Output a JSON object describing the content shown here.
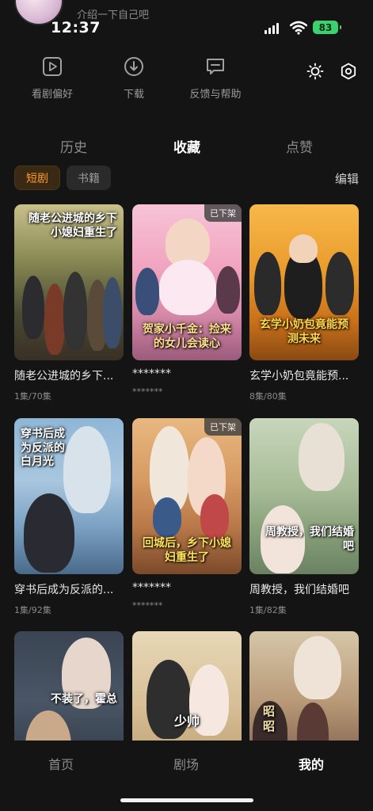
{
  "profile": {
    "intro": "介绍一下自己吧"
  },
  "status_bar": {
    "time": "12:37",
    "battery": "83"
  },
  "quick_actions": [
    {
      "label": "看剧偏好",
      "icon": "play-square-icon"
    },
    {
      "label": "下载",
      "icon": "download-icon"
    },
    {
      "label": "反馈与帮助",
      "icon": "feedback-icon"
    }
  ],
  "top_icons": [
    "brightness-icon",
    "settings-icon"
  ],
  "tabs": {
    "history": "历史",
    "favorites": "收藏",
    "likes": "点赞",
    "active": "收藏"
  },
  "filters": {
    "short_drama": "短剧",
    "books": "书籍",
    "edit": "编辑"
  },
  "cards": [
    {
      "title": "随老公进城的乡下...",
      "meta": "1集/70集",
      "poster_text": "随老公进城的乡下小媳妇重生了",
      "badge": ""
    },
    {
      "title": "*******",
      "meta": "*******",
      "poster_text": "贺家小千金：捡来的女儿会读心",
      "badge": "已下架"
    },
    {
      "title": "玄学小奶包竟能预...",
      "meta": "8集/80集",
      "poster_text": "玄学小奶包竟能预测未来",
      "badge": ""
    },
    {
      "title": "穿书后成为反派的...",
      "meta": "1集/92集",
      "poster_text": "穿书后成为反派的白月光",
      "badge": ""
    },
    {
      "title": "*******",
      "meta": "*******",
      "poster_text": "回城后，乡下小媳妇重生了",
      "badge": "已下架"
    },
    {
      "title": "周教授，我们结婚吧",
      "meta": "1集/82集",
      "poster_text": "周教授，我们结婚吧",
      "badge": ""
    },
    {
      "title": "",
      "meta": "",
      "poster_text": "不装了，霍总",
      "badge": ""
    },
    {
      "title": "",
      "meta": "",
      "poster_text": "少帅",
      "badge": ""
    },
    {
      "title": "",
      "meta": "",
      "poster_text": "昭昭",
      "badge": ""
    }
  ],
  "bottom_nav": {
    "home": "首页",
    "theater": "剧场",
    "mine": "我的",
    "active": "我的"
  },
  "colors": {
    "accent": "#ff9a2a",
    "background": "#141414",
    "battery": "#3bd16f"
  }
}
